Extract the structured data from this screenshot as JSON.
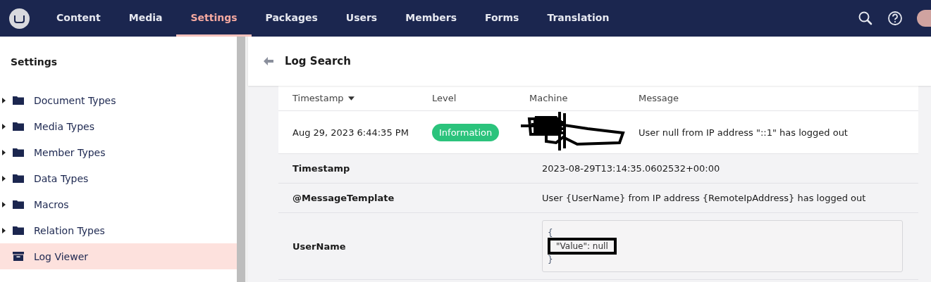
{
  "top_nav": {
    "items": [
      {
        "label": "Content",
        "selected": false
      },
      {
        "label": "Media",
        "selected": false
      },
      {
        "label": "Settings",
        "selected": true
      },
      {
        "label": "Packages",
        "selected": false
      },
      {
        "label": "Users",
        "selected": false
      },
      {
        "label": "Members",
        "selected": false
      },
      {
        "label": "Forms",
        "selected": false
      },
      {
        "label": "Translation",
        "selected": false
      }
    ]
  },
  "sidebar": {
    "title": "Settings",
    "items": [
      {
        "label": "Document Types",
        "kind": "folder",
        "selected": false
      },
      {
        "label": "Media Types",
        "kind": "folder",
        "selected": false
      },
      {
        "label": "Member Types",
        "kind": "folder",
        "selected": false
      },
      {
        "label": "Data Types",
        "kind": "folder",
        "selected": false
      },
      {
        "label": "Macros",
        "kind": "folder",
        "selected": false
      },
      {
        "label": "Relation Types",
        "kind": "folder",
        "selected": false
      },
      {
        "label": "Log Viewer",
        "kind": "archive",
        "selected": true
      }
    ]
  },
  "header": {
    "title": "Log Search"
  },
  "table": {
    "columns": [
      "Timestamp",
      "Level",
      "Machine",
      "Message"
    ],
    "rows": [
      {
        "timestamp": "Aug 29, 2023 6:44:35 PM",
        "level": "Information",
        "message": "User null from IP address \"::1\" has logged out"
      }
    ],
    "details": [
      {
        "kind": "text",
        "label": "Timestamp",
        "value": "2023-08-29T13:14:35.0602532+00:00"
      },
      {
        "kind": "text",
        "label": "@MessageTemplate",
        "value": "User {UserName} from IP address {RemoteIpAddress} has logged out"
      },
      {
        "kind": "json",
        "label": "UserName",
        "lines": [
          "{",
          "\"Value\": null",
          "}"
        ]
      }
    ]
  }
}
